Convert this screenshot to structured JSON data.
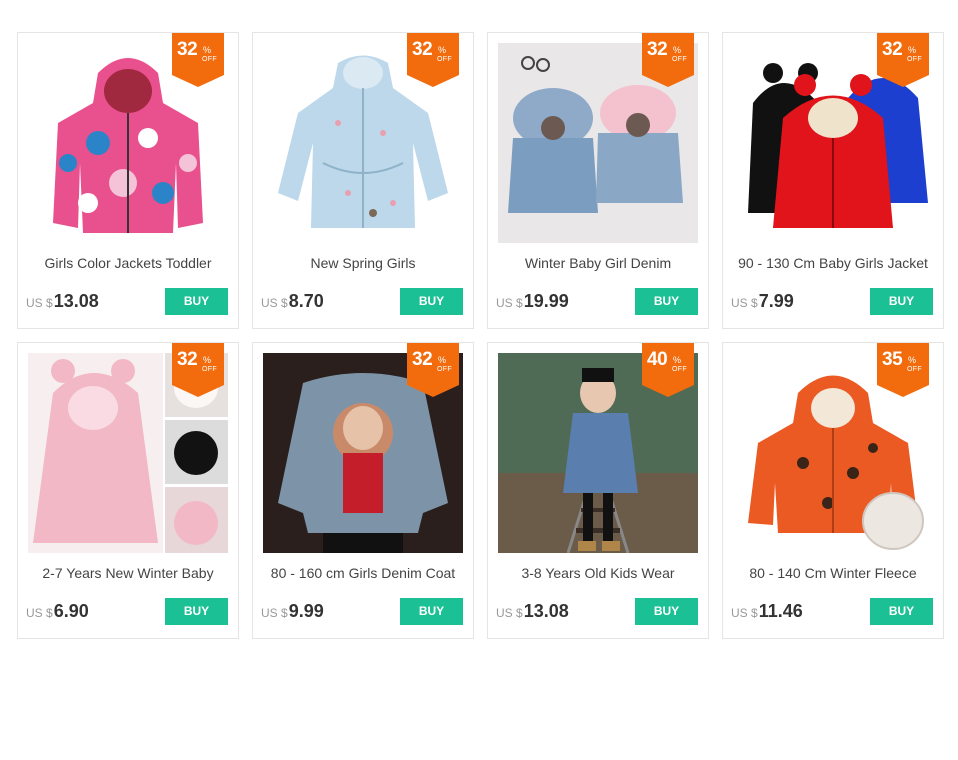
{
  "colors": {
    "badge": "#f26c0d",
    "buy_button": "#1cc095",
    "price": "#333333"
  },
  "labels": {
    "off": "OFF",
    "percent": "%",
    "currency": "US $",
    "buy": "BUY"
  },
  "products": [
    {
      "title": "Girls Color Jackets Toddler",
      "price": "13.08",
      "discount": "32",
      "image_icon": "pink-hooded-jacket-image"
    },
    {
      "title": "New Spring Girls",
      "price": "8.70",
      "discount": "32",
      "image_icon": "light-blue-trench-coat-image"
    },
    {
      "title": "Winter Baby Girl Denim",
      "price": "19.99",
      "discount": "32",
      "image_icon": "denim-fur-jackets-image"
    },
    {
      "title": "90 - 130 Cm Baby Girls Jacket",
      "price": "7.99",
      "discount": "32",
      "image_icon": "puffer-jackets-image"
    },
    {
      "title": "2-7 Years New Winter Baby",
      "price": "6.90",
      "discount": "32",
      "image_icon": "pink-fur-coat-image"
    },
    {
      "title": "80 - 160 cm Girls Denim Coat",
      "price": "9.99",
      "discount": "32",
      "image_icon": "denim-coat-back-image"
    },
    {
      "title": "3-8 Years Old Kids Wear",
      "price": "13.08",
      "discount": "40",
      "image_icon": "girl-on-railway-image"
    },
    {
      "title": "80 - 140 Cm Winter Fleece",
      "price": "11.46",
      "discount": "35",
      "image_icon": "orange-fleece-jacket-image"
    }
  ]
}
